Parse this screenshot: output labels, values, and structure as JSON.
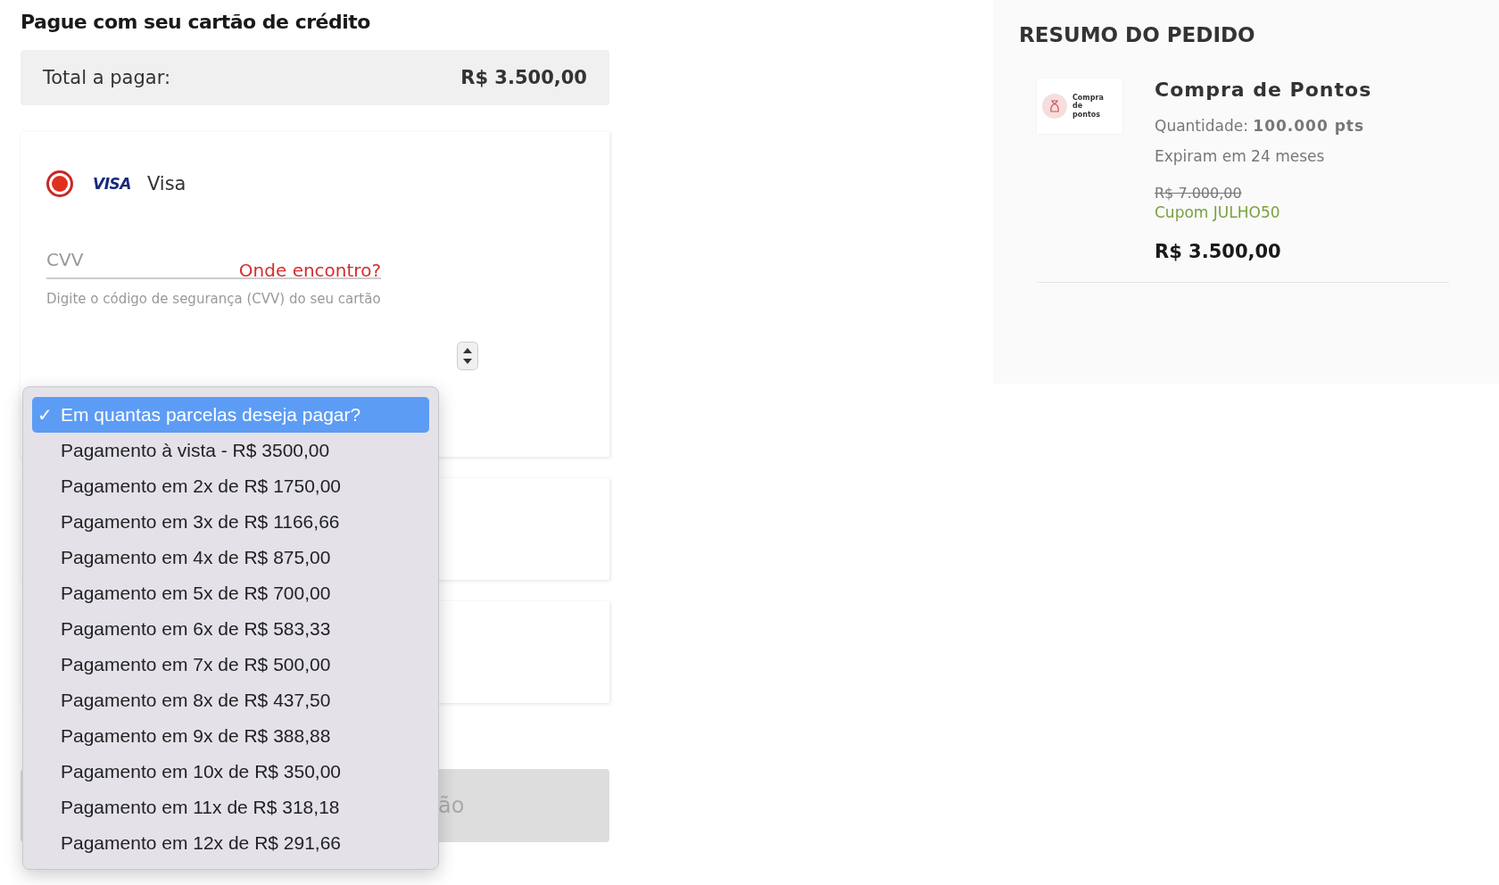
{
  "page_title": "Pague com seu cartão de crédito",
  "total": {
    "label": "Total a pagar:",
    "value": "R$ 3.500,00"
  },
  "payment_method": {
    "brand_logo": "VISA",
    "label": "Visa",
    "selected": true
  },
  "cvv": {
    "placeholder": "CVV",
    "help_link": "Onde encontro?",
    "hint": "Digite o código de segurança (CVV) do seu cartão"
  },
  "installments": {
    "check_mark": "✓",
    "options": [
      {
        "label": "Em quantas parcelas deseja pagar?",
        "selected": true
      },
      {
        "label": "Pagamento à vista - R$ 3500,00",
        "selected": false
      },
      {
        "label": "Pagamento em 2x de R$ 1750,00",
        "selected": false
      },
      {
        "label": "Pagamento em 3x de R$ 1166,66",
        "selected": false
      },
      {
        "label": "Pagamento em 4x de R$ 875,00",
        "selected": false
      },
      {
        "label": "Pagamento em 5x de R$ 700,00",
        "selected": false
      },
      {
        "label": "Pagamento em 6x de R$ 583,33",
        "selected": false
      },
      {
        "label": "Pagamento em 7x de R$ 500,00",
        "selected": false
      },
      {
        "label": "Pagamento em 8x de R$ 437,50",
        "selected": false
      },
      {
        "label": "Pagamento em 9x de R$ 388,88",
        "selected": false
      },
      {
        "label": "Pagamento em 10x de R$ 350,00",
        "selected": false
      },
      {
        "label": "Pagamento em 11x de R$ 318,18",
        "selected": false
      },
      {
        "label": "Pagamento em 12x de R$ 291,66",
        "selected": false
      }
    ]
  },
  "submit_button": {
    "label": "ão",
    "disabled": true
  },
  "summary": {
    "title": "RESUMO DO PEDIDO",
    "thumbnail_text": "Compra de pontos",
    "product_name": "Compra de Pontos",
    "quantity": "Quantidade: **100.000 pts**",
    "expiry": "Expiram em 24 meses",
    "old_price": "R$ 7.000,00",
    "coupon": "Cupom JULHO50",
    "price": "R$ 3.500,00"
  }
}
